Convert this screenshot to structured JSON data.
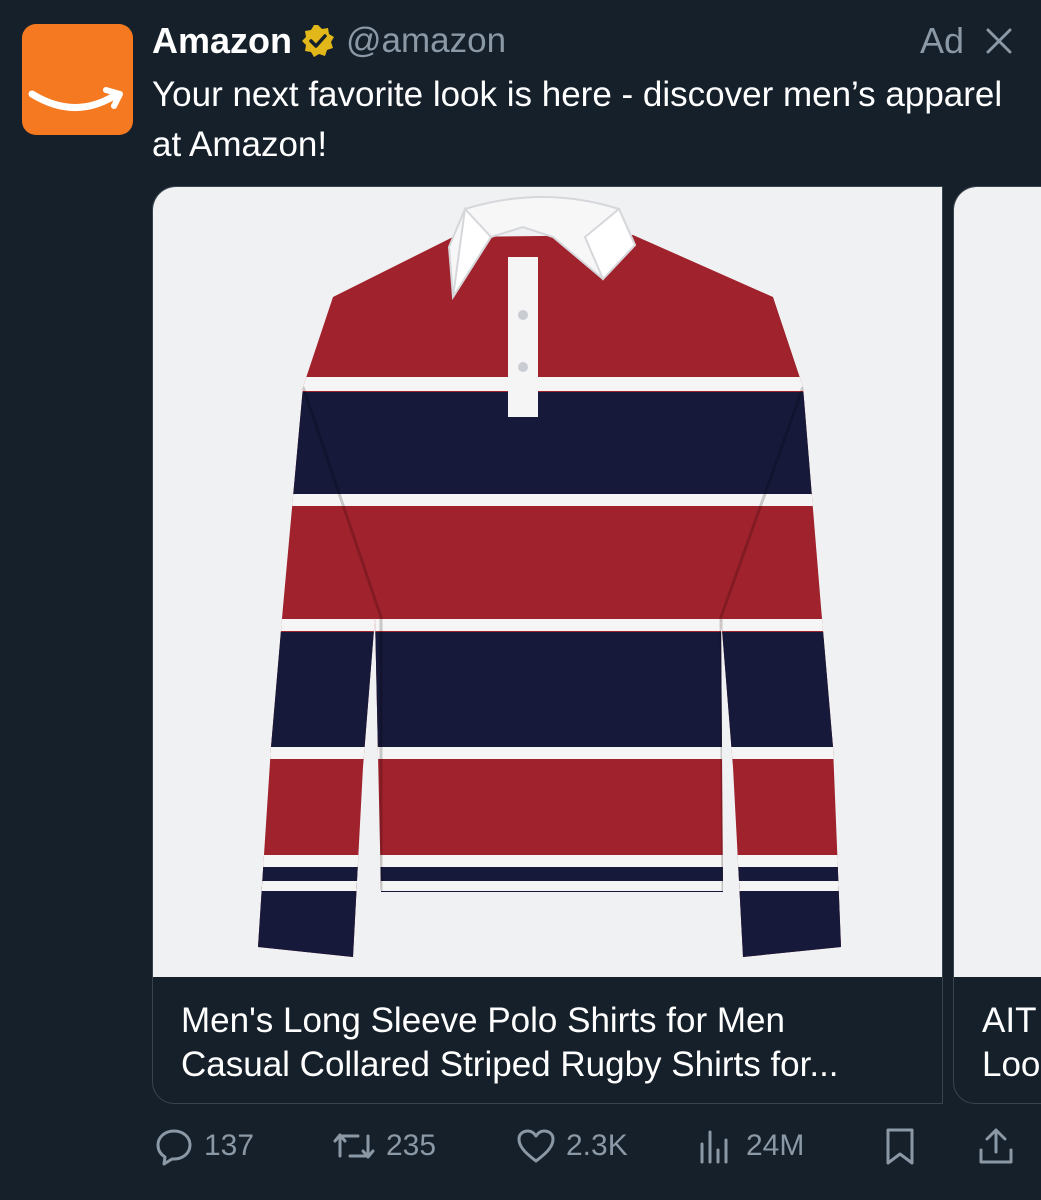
{
  "post": {
    "display_name": "Amazon",
    "handle": "@amazon",
    "ad_label": "Ad",
    "text": "Your next favorite look is here - discover men’s apparel at Amazon!"
  },
  "cards": [
    {
      "title_line1": "Men's Long Sleeve Polo Shirts for Men",
      "title_line2": "Casual Collared Striped Rugby Shirts for...",
      "image": "striped-rugby-shirt-image"
    },
    {
      "title_line1": "AIT",
      "title_line2": "Loo",
      "image": "product-image"
    }
  ],
  "actions": {
    "replies": "137",
    "reposts": "235",
    "likes": "2.3K",
    "views": "24M"
  },
  "icons": {
    "avatar": "amazon-smile-logo",
    "verified": "verified-badge-icon",
    "close": "close-icon",
    "reply": "reply-icon",
    "repost": "repost-icon",
    "like": "heart-icon",
    "views": "views-icon",
    "bookmark": "bookmark-icon",
    "share": "share-icon"
  },
  "colors": {
    "background": "#15202b",
    "secondary_text": "#8b98a5",
    "brand_orange": "#f47920",
    "verified_gold": "#e2b719",
    "shirt_red": "#a0222c",
    "shirt_navy": "#16193a"
  }
}
